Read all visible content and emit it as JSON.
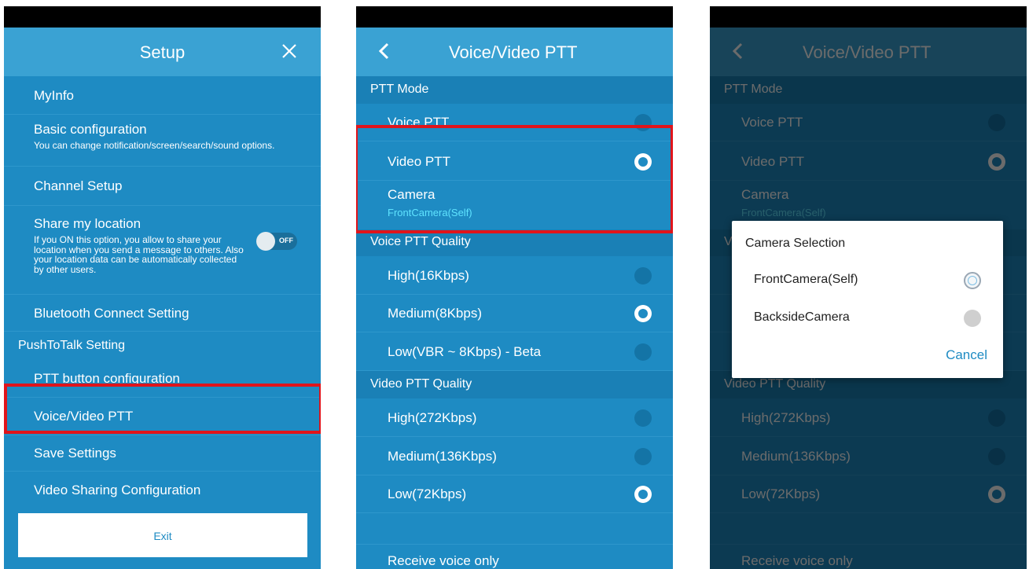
{
  "setup": {
    "title": "Setup",
    "items": [
      {
        "title": "MyInfo"
      },
      {
        "title": "Basic configuration",
        "subtitle": "You can change notification/screen/search/sound options."
      },
      {
        "title": "Channel Setup"
      },
      {
        "title": "Share my location",
        "subtitle": "If you ON this option, you allow to share your location when you send a message to others. Also your location data can be automatically collected by other users.",
        "toggle_label": "OFF"
      },
      {
        "title": "Bluetooth Connect Setting"
      }
    ],
    "section": "PushToTalk Setting",
    "items2": [
      {
        "title": "PTT button configuration"
      },
      {
        "title": "Voice/Video PTT"
      },
      {
        "title": "Save Settings"
      },
      {
        "title": "Video Sharing Configuration"
      }
    ],
    "exit_label": "Exit"
  },
  "ptt": {
    "title": "Voice/Video PTT",
    "mode_section": "PTT Mode",
    "mode_items": [
      {
        "label": "Voice PTT",
        "selected": false
      },
      {
        "label": "Video PTT",
        "selected": true
      }
    ],
    "camera_label": "Camera",
    "camera_value": "FrontCamera(Self)",
    "voice_section": "Voice PTT Quality",
    "voice_items": [
      {
        "label": "High(16Kbps)",
        "selected": false
      },
      {
        "label": "Medium(8Kbps)",
        "selected": true
      },
      {
        "label": "Low(VBR ~ 8Kbps) - Beta",
        "selected": false
      }
    ],
    "video_section": "Video PTT Quality",
    "video_items": [
      {
        "label": "High(272Kbps)",
        "selected": false
      },
      {
        "label": "Medium(136Kbps)",
        "selected": false
      },
      {
        "label": "Low(72Kbps)",
        "selected": true
      }
    ],
    "receive_label": "Receive voice only"
  },
  "dialog": {
    "title": "Camera Selection",
    "options": [
      {
        "label": "FrontCamera(Self)",
        "selected": true
      },
      {
        "label": "BacksideCamera",
        "selected": false
      }
    ],
    "cancel_label": "Cancel"
  },
  "colors": {
    "accent": "#1e8bc3",
    "header": "#3aa2d3",
    "highlight": "#e0141b",
    "camera_value": "#5fe3ff"
  }
}
